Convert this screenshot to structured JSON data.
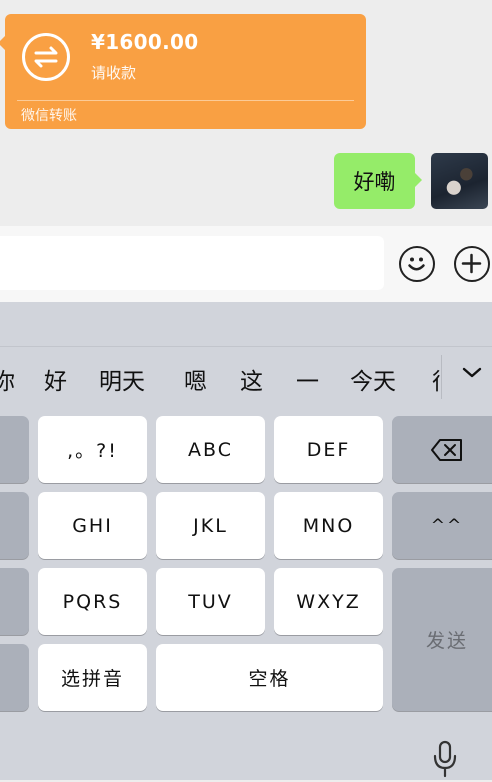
{
  "chat": {
    "transfer": {
      "amount": "¥1600.00",
      "status": "请收款",
      "source": "微信转账",
      "color": "#f9a043"
    },
    "message": {
      "text": "好嘞",
      "color": "#95ec69"
    },
    "avatar_icon": "user-avatar-photo"
  },
  "input_bar": {
    "emoji_icon": "smile-icon",
    "plus_icon": "plus-circle-icon"
  },
  "keyboard": {
    "candidates": [
      "你",
      "好",
      "明天",
      "嗯",
      "这",
      "一",
      "今天",
      "很"
    ],
    "expand_icon": "chevron-down-icon",
    "keys": {
      "punct": ",。?!",
      "abc": "ABC",
      "def": "DEF",
      "ghi": "GHI",
      "jkl": "JKL",
      "mno": "MNO",
      "pqrs": "PQRS",
      "tuv": "TUV",
      "wxyz": "WXYZ",
      "pinyin": "选拼音",
      "space": "空格",
      "emoticon": "^^",
      "send": "发送"
    },
    "backspace_icon": "backspace-icon",
    "mic_icon": "microphone-icon"
  }
}
